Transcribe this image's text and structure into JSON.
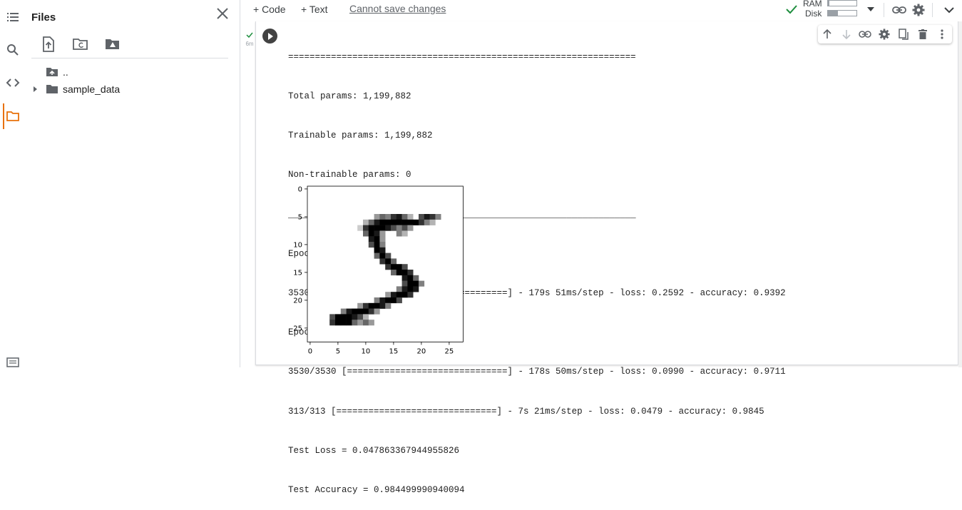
{
  "sidebar": {
    "icons": [
      "toc-icon",
      "search-icon",
      "code-icon",
      "folder-icon",
      "terminal-icon"
    ]
  },
  "files_panel": {
    "title": "Files",
    "tree": [
      {
        "name": "..",
        "icon": "folder-up-icon"
      },
      {
        "name": "sample_data",
        "icon": "folder-icon"
      }
    ]
  },
  "toolbar": {
    "add_code": "+ Code",
    "add_text": "+ Text",
    "save_status": "Cannot save changes",
    "ram_label": "RAM",
    "disk_label": "Disk",
    "ram_usage": 0.05,
    "disk_usage": 0.35,
    "status_color": "#1e8e3e"
  },
  "cell": {
    "exec_time": "6m",
    "output_lines": [
      "=================================================================",
      "Total params: 1,199,882",
      "Trainable params: 1,199,882",
      "Non-trainable params: 0",
      "_________________________________________________________________",
      "Epoch 1/2",
      "3530/3530 [==============================] - 179s 51ms/step - loss: 0.2592 - accuracy: 0.9392",
      "Epoch 2/2",
      "3530/3530 [==============================] - 178s 50ms/step - loss: 0.0990 - accuracy: 0.9711",
      "313/313 [==============================] - 7s 21ms/step - loss: 0.0479 - accuracy: 0.9845",
      "Test Loss = 0.047863367944955826",
      "Test Accuracy = 0.984499990940094"
    ]
  },
  "chart_data": {
    "type": "heatmap",
    "title": "",
    "xlabel": "",
    "ylabel": "",
    "xticks": [
      "0",
      "5",
      "10",
      "15",
      "20",
      "25"
    ],
    "yticks": [
      "0",
      "5",
      "10",
      "15",
      "20",
      "25"
    ],
    "xlim": [
      -0.5,
      27.5
    ],
    "ylim": [
      27.5,
      -0.5
    ],
    "colormap": "binary",
    "grid": false,
    "pixels": [
      [
        5,
        12,
        0.4
      ],
      [
        5,
        13,
        0.6
      ],
      [
        5,
        14,
        0.5
      ],
      [
        5,
        15,
        0.8
      ],
      [
        5,
        16,
        0.9
      ],
      [
        5,
        17,
        0.6
      ],
      [
        5,
        18,
        0.3
      ],
      [
        5,
        20,
        0.7
      ],
      [
        5,
        21,
        0.9
      ],
      [
        5,
        22,
        0.8
      ],
      [
        5,
        23,
        0.5
      ],
      [
        6,
        10,
        0.3
      ],
      [
        6,
        11,
        0.6
      ],
      [
        6,
        12,
        0.9
      ],
      [
        6,
        13,
        1
      ],
      [
        6,
        14,
        1
      ],
      [
        6,
        15,
        1
      ],
      [
        6,
        16,
        1
      ],
      [
        6,
        17,
        1
      ],
      [
        6,
        18,
        1
      ],
      [
        6,
        19,
        1
      ],
      [
        6,
        20,
        0.8
      ],
      [
        6,
        21,
        0.5
      ],
      [
        6,
        22,
        0.3
      ],
      [
        7,
        9,
        0.2
      ],
      [
        7,
        10,
        0.8
      ],
      [
        7,
        11,
        1
      ],
      [
        7,
        12,
        1
      ],
      [
        7,
        13,
        1
      ],
      [
        7,
        14,
        0.9
      ],
      [
        7,
        15,
        0.7
      ],
      [
        7,
        16,
        0.5
      ],
      [
        7,
        17,
        0.7
      ],
      [
        7,
        18,
        0.4
      ],
      [
        8,
        10,
        0.6
      ],
      [
        8,
        11,
        1
      ],
      [
        8,
        12,
        0.9
      ],
      [
        8,
        13,
        0.4
      ],
      [
        8,
        16,
        0.5
      ],
      [
        8,
        17,
        0.3
      ],
      [
        9,
        11,
        0.9
      ],
      [
        9,
        12,
        1
      ],
      [
        9,
        13,
        0.4
      ],
      [
        10,
        11,
        0.7
      ],
      [
        10,
        12,
        1
      ],
      [
        10,
        13,
        0.5
      ],
      [
        11,
        12,
        1
      ],
      [
        11,
        13,
        0.9
      ],
      [
        12,
        12,
        0.6
      ],
      [
        12,
        13,
        1
      ],
      [
        12,
        14,
        0.7
      ],
      [
        13,
        13,
        0.8
      ],
      [
        13,
        14,
        1
      ],
      [
        13,
        15,
        0.6
      ],
      [
        14,
        14,
        0.8
      ],
      [
        14,
        15,
        1
      ],
      [
        14,
        16,
        1
      ],
      [
        14,
        17,
        0.7
      ],
      [
        15,
        15,
        0.6
      ],
      [
        15,
        16,
        1
      ],
      [
        15,
        17,
        1
      ],
      [
        15,
        18,
        0.8
      ],
      [
        16,
        17,
        0.9
      ],
      [
        16,
        18,
        1
      ],
      [
        16,
        19,
        0.6
      ],
      [
        17,
        17,
        0.7
      ],
      [
        17,
        18,
        1
      ],
      [
        17,
        19,
        1
      ],
      [
        17,
        20,
        0.5
      ],
      [
        18,
        16,
        0.5
      ],
      [
        18,
        17,
        0.9
      ],
      [
        18,
        18,
        1
      ],
      [
        18,
        19,
        0.9
      ],
      [
        19,
        14,
        0.4
      ],
      [
        19,
        15,
        0.9
      ],
      [
        19,
        16,
        1
      ],
      [
        19,
        17,
        1
      ],
      [
        19,
        18,
        0.8
      ],
      [
        20,
        12,
        0.5
      ],
      [
        20,
        13,
        0.9
      ],
      [
        20,
        14,
        1
      ],
      [
        20,
        15,
        1
      ],
      [
        20,
        16,
        0.7
      ],
      [
        21,
        9,
        0.4
      ],
      [
        21,
        10,
        0.8
      ],
      [
        21,
        11,
        1
      ],
      [
        21,
        12,
        1
      ],
      [
        21,
        13,
        0.9
      ],
      [
        21,
        14,
        0.5
      ],
      [
        22,
        6,
        0.5
      ],
      [
        22,
        7,
        0.9
      ],
      [
        22,
        8,
        1
      ],
      [
        22,
        9,
        1
      ],
      [
        22,
        10,
        1
      ],
      [
        22,
        11,
        0.8
      ],
      [
        22,
        12,
        0.4
      ],
      [
        23,
        4,
        0.7
      ],
      [
        23,
        5,
        1
      ],
      [
        23,
        6,
        1
      ],
      [
        23,
        7,
        1
      ],
      [
        23,
        8,
        0.9
      ],
      [
        23,
        9,
        0.7
      ],
      [
        23,
        10,
        0.3
      ],
      [
        24,
        4,
        0.8
      ],
      [
        24,
        5,
        1
      ],
      [
        24,
        6,
        1
      ],
      [
        24,
        7,
        1
      ],
      [
        24,
        8,
        0.6
      ],
      [
        24,
        9,
        0.4
      ],
      [
        24,
        10,
        0.6
      ],
      [
        24,
        11,
        0.4
      ]
    ]
  }
}
